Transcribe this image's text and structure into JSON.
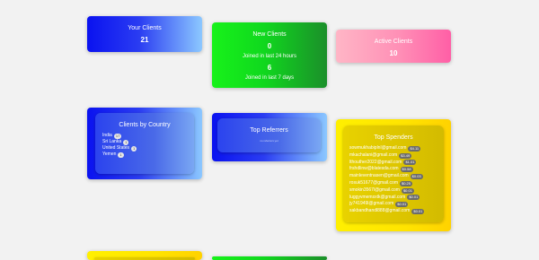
{
  "cards": {
    "your_clients": {
      "title": "Your Clients",
      "value": "21"
    },
    "new_clients": {
      "title": "New Clients",
      "value_24h": "0",
      "label_24h": "Joined in last 24 hours",
      "value_7d": "6",
      "label_7d": "Joined in last 7 days"
    },
    "active_clients": {
      "title": "Active Clients",
      "value": "10"
    },
    "clients_by_country": {
      "title": "Clients by Country",
      "rows": [
        {
          "name": "India",
          "count": "17"
        },
        {
          "name": "Sri Lanka",
          "count": "1"
        },
        {
          "name": "United States",
          "count": "1"
        },
        {
          "name": "Yemen",
          "count": "1"
        }
      ]
    },
    "top_referrers": {
      "title": "Top Referrers",
      "note": "no referrers yet"
    },
    "top_spenders": {
      "title": "Top Spenders",
      "rows": [
        {
          "email": "sowmukhabiplnl@gmail.com",
          "amount": "$4.11"
        },
        {
          "email": "mkachalani@gmail.com",
          "amount": "$3.49"
        },
        {
          "email": "lthouther2022@gmail.com",
          "amount": "$1.01"
        },
        {
          "email": "frshdlinw@blatesda.com",
          "amount": "$0.58"
        },
        {
          "email": "mainleventnasen@gmail.com",
          "amount": "$0.03"
        },
        {
          "email": "rosuk51677@gmail.com",
          "amount": "$0.25"
        },
        {
          "email": "smokin3567l@gmail.com",
          "amount": "$0.01"
        },
        {
          "email": "luggyvmemsxtk@gmail.com",
          "amount": "$0.01"
        },
        {
          "email": "jy741949l@gmail.com",
          "amount": "$0.01"
        },
        {
          "email": "sakbandhandl888@gmail.com",
          "amount": "$0.01"
        }
      ]
    }
  },
  "colors": {
    "background": "#f2f2f2",
    "blue": "#0a12f0",
    "green": "#17f21a",
    "pink": "#ff8fb6",
    "yellow": "#fff000"
  }
}
